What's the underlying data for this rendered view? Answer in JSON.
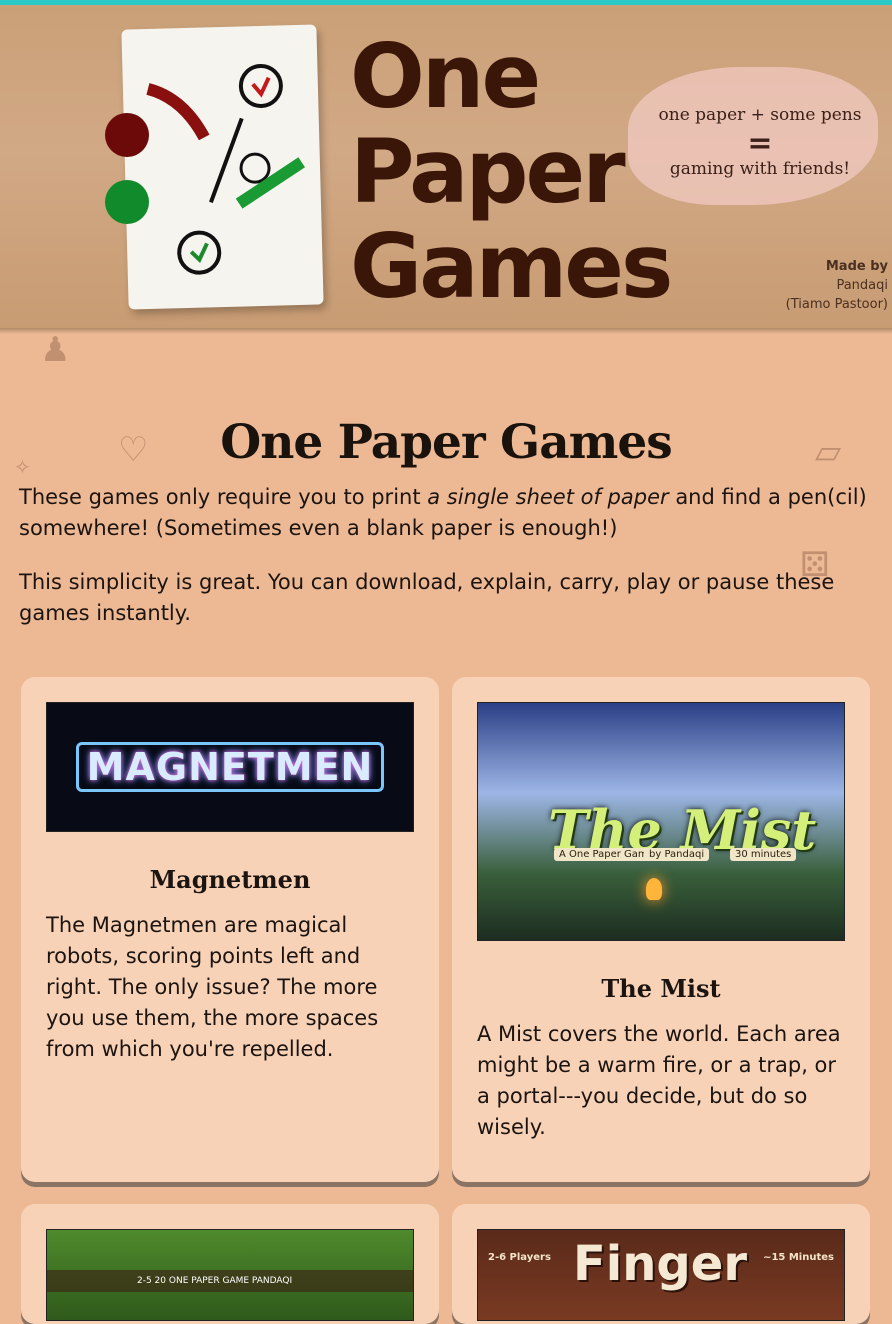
{
  "banner": {
    "logo_line1": "One",
    "logo_line2": "Paper",
    "logo_line3": "Games",
    "tagline_top": "one paper + some pens",
    "tagline_equals": "=",
    "tagline_bottom": "gaming with friends!",
    "madeby_label": "Made by",
    "madeby_name": "Pandaqi",
    "madeby_author": "(Tiamo Pastoor)"
  },
  "page": {
    "title": "One Paper Games",
    "intro1_before": "These games only require you to print ",
    "intro1_em": "a single sheet of paper",
    "intro1_after": " and find a pen(cil) somewhere! (Sometimes even a blank paper is enough!)",
    "intro2": "This simplicity is great. You can download, explain, carry, play or pause these games instantly."
  },
  "cards": [
    {
      "title": "Magnetmen",
      "image_logo": "MAGNETMEN",
      "description": "The Magnetmen are magical robots, scoring points left and right. The only issue? The more you use them, the more spaces from which you're repelled."
    },
    {
      "title": "The Mist",
      "image_logo": "The Mist",
      "image_sub1": "A One Paper Game",
      "image_sub2": "by Pandaqi",
      "image_sub3": "30 minutes",
      "description": "A Mist covers the world. Each area might be a warm fire, or a trap, or a portal---you decide, but do so wisely."
    },
    {
      "image_strip": "2-5   20   ONE PAPER GAME   PANDAQI"
    },
    {
      "image_left": "2-6 Players",
      "image_logo": "Finger",
      "image_right": "~15 Minutes"
    }
  ],
  "colors": {
    "top_line": "#2ec9c6",
    "background": "#edb994",
    "card": "#f7d2b7",
    "logo_brown": "#3a1608"
  }
}
